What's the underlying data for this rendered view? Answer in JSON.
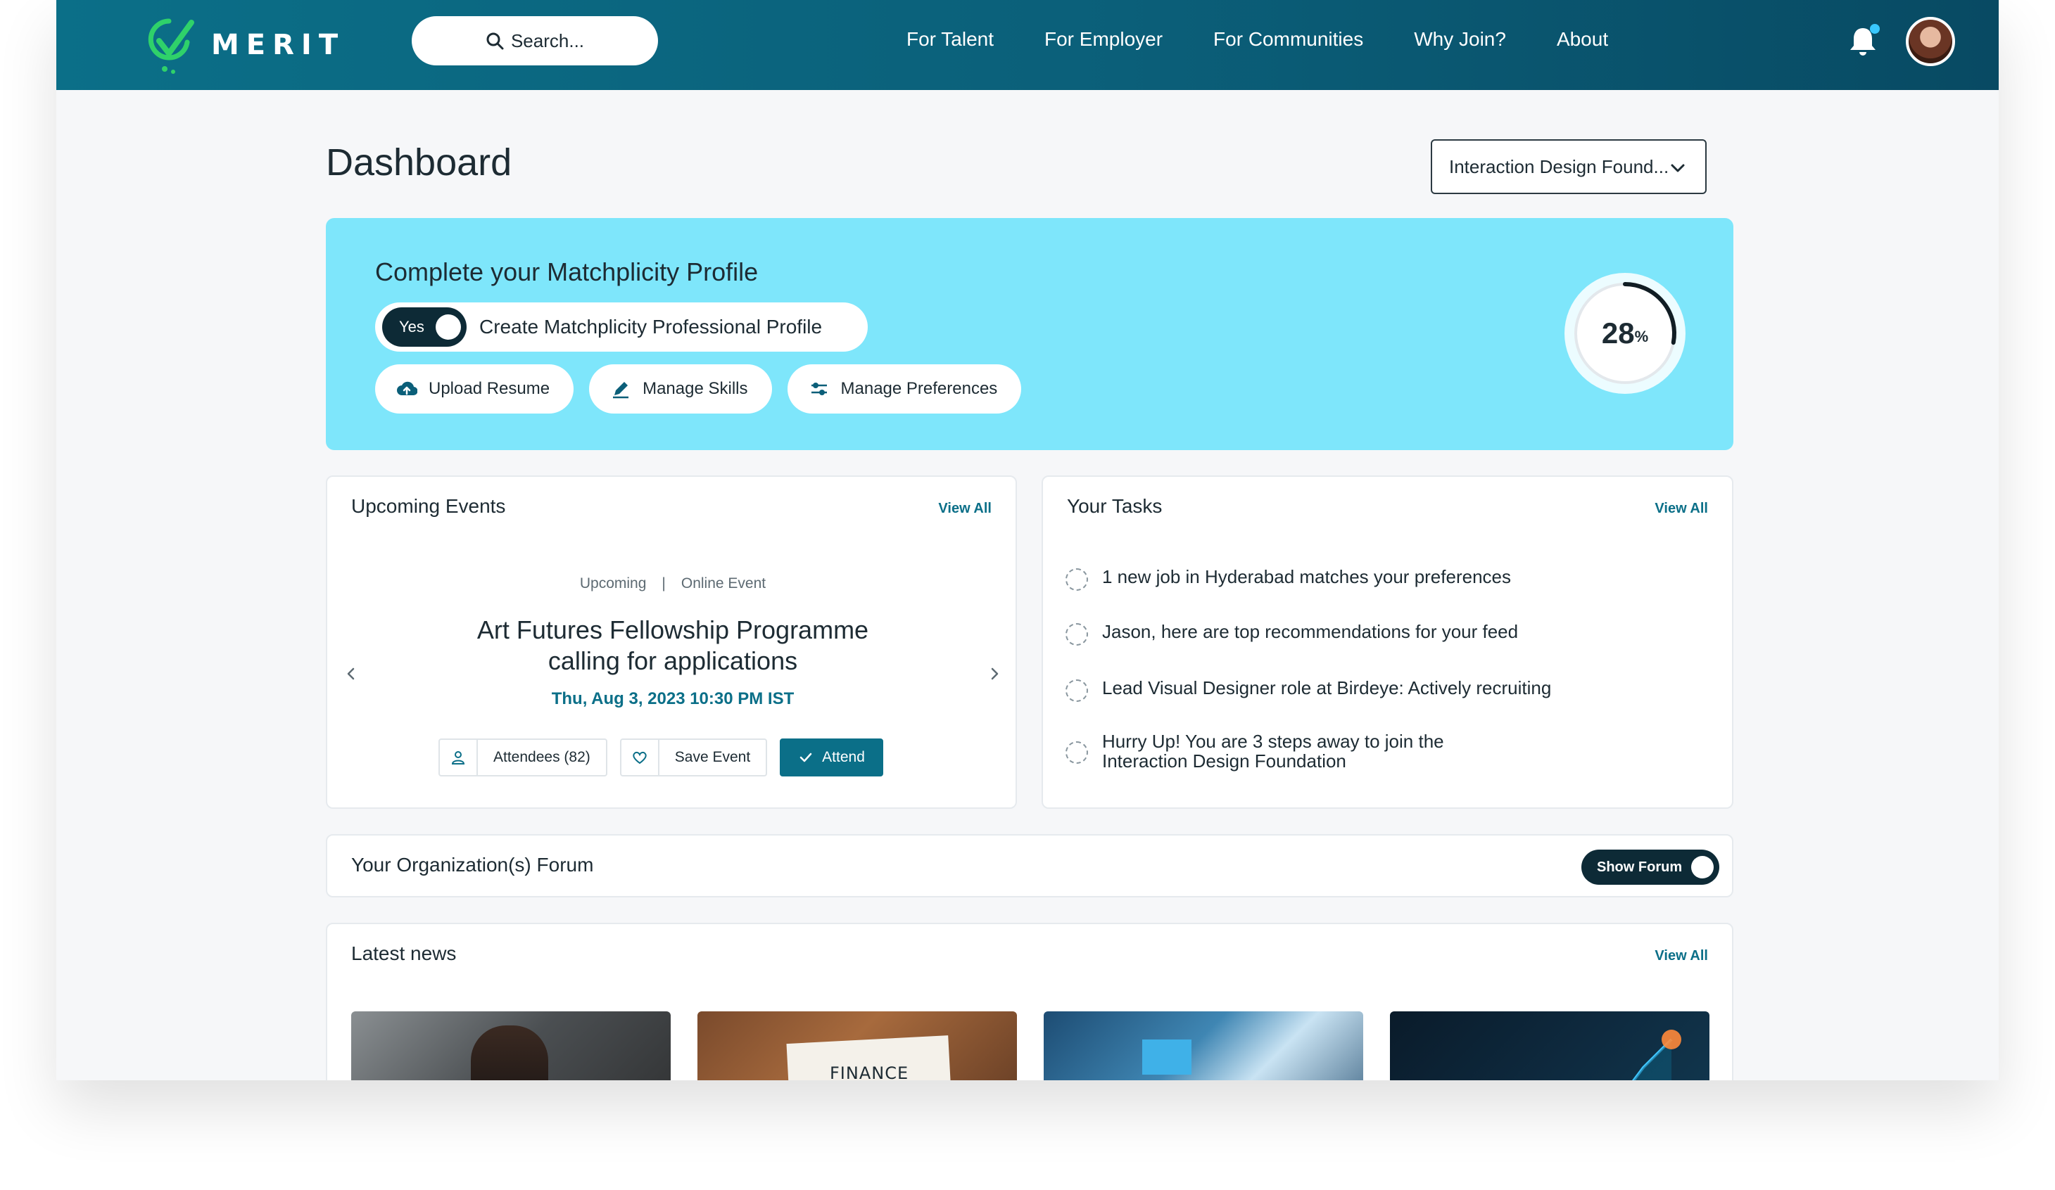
{
  "brand": {
    "name": "MERIT",
    "logo_icon": "merit-check-logo"
  },
  "search": {
    "placeholder": "Search..."
  },
  "nav": {
    "items": [
      "For Talent",
      "For Employer",
      "For Communities",
      "Why Join?",
      "About"
    ]
  },
  "header": {
    "notifications_icon": "bell-icon",
    "has_unread": true
  },
  "page": {
    "title": "Dashboard"
  },
  "org_selector": {
    "value": "Interaction Design Found..."
  },
  "profile_completion": {
    "title": "Complete your Matchplicity Profile",
    "toggle_state": "Yes",
    "toggle_label": "Create Matchplicity Professional Profile",
    "actions": [
      "Upload Resume",
      "Manage Skills",
      "Manage Preferences"
    ],
    "progress_value": "28",
    "progress_unit": "%",
    "progress_fraction": 0.28
  },
  "events": {
    "title": "Upcoming Events",
    "view_all": "View All",
    "status": "Upcoming",
    "type": "Online Event",
    "event_title": "Art Futures Fellowship Programme calling for applications",
    "date": "Thu, Aug 3, 2023 10:30 PM IST",
    "attendees_label": "Attendees (82)",
    "save_label": "Save Event",
    "attend_label": "Attend"
  },
  "tasks": {
    "title": "Your Tasks",
    "view_all": "View All",
    "items": [
      "1 new job in Hyderabad matches your preferences",
      "Jason, here are top recommendations for your feed",
      "Lead Visual Designer role at Birdeye: Actively recruiting",
      "Hurry Up! You are 3 steps away to join the Interaction Design Foundation"
    ]
  },
  "forum": {
    "title": "Your Organization(s) Forum",
    "toggle_label": "Show Forum"
  },
  "news": {
    "title": "Latest news",
    "view_all": "View All",
    "thumb_2_caption": "FINANCE"
  },
  "colors": {
    "brand": "#0b6f88",
    "banner": "#7ee6fb",
    "toggle_dark": "#0d2a36",
    "logo_green": "#2fd16a"
  }
}
